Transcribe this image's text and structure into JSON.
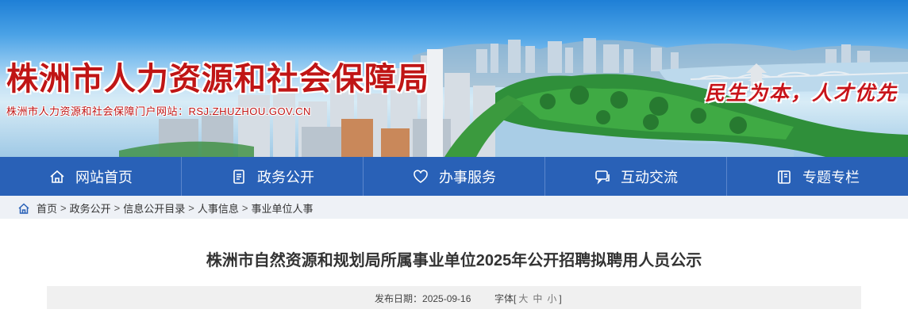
{
  "header": {
    "site_title": "株洲市人力资源和社会保障局",
    "site_subtitle": "株洲市人力资源和社会保障门户网站：RSJ.ZHUZHOU.GOV.CN",
    "slogan": "民生为本，人才优先"
  },
  "nav": {
    "items": [
      {
        "label": "网站首页",
        "icon": "home-icon"
      },
      {
        "label": "政务公开",
        "icon": "document-icon"
      },
      {
        "label": "办事服务",
        "icon": "heart-icon"
      },
      {
        "label": "互动交流",
        "icon": "chat-icon"
      },
      {
        "label": "专题专栏",
        "icon": "book-icon"
      }
    ]
  },
  "breadcrumb": {
    "separator": ">",
    "items": [
      "首页",
      "政务公开",
      "信息公开目录",
      "人事信息",
      "事业单位人事"
    ]
  },
  "article": {
    "title": "株洲市自然资源和规划局所属事业单位2025年公开招聘拟聘用人员公示",
    "date_label": "发布日期：",
    "date": "2025-09-16",
    "font_label": "字体",
    "font_open": "[",
    "font_large": "大",
    "font_medium": "中",
    "font_small": "小",
    "font_close": "]"
  },
  "colors": {
    "nav_bg": "#2961b7",
    "title_red": "#c01515",
    "breadcrumb_bg": "#eef1f6"
  }
}
